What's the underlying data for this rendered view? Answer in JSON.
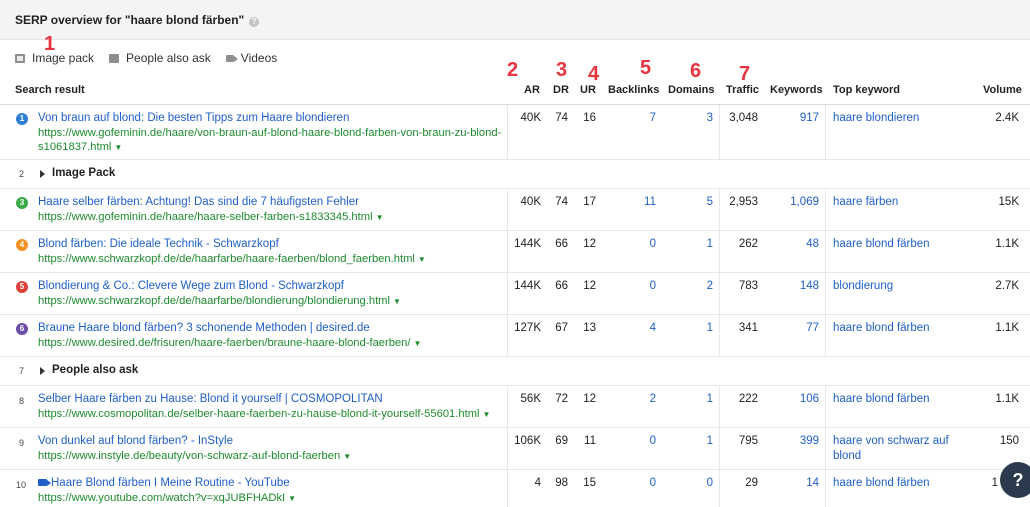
{
  "title": "SERP overview for \"haare blond färben\"",
  "help_glyph": "?",
  "features": [
    {
      "label": "Image pack",
      "icon": "image-icon"
    },
    {
      "label": "People also ask",
      "icon": "comment-icon"
    },
    {
      "label": "Videos",
      "icon": "video-icon"
    }
  ],
  "annotations": [
    "1",
    "2",
    "3",
    "4",
    "5",
    "6",
    "7"
  ],
  "columns": {
    "result": "Search result",
    "ar": "AR",
    "dr": "DR",
    "ur": "UR",
    "backlinks": "Backlinks",
    "domains": "Domains",
    "traffic": "Traffic",
    "keywords": "Keywords",
    "top_keyword": "Top keyword",
    "volume": "Volume"
  },
  "rows": [
    {
      "pos": "1",
      "title": "Von braun auf blond: Die besten Tipps zum Haare blondieren",
      "url": "https://www.gofeminin.de/haare/von-braun-auf-blond-haare-blond-farben-von-braun-zu-blond-",
      "url2": "s1061837.html",
      "ar": "40K",
      "dr": "74",
      "ur": "16",
      "backlinks": "7",
      "domains": "3",
      "traffic": "3,048",
      "keywords": "917",
      "top_keyword": "haare blondieren",
      "volume": "2.4K"
    },
    {
      "pos": "2",
      "group": "Image Pack"
    },
    {
      "pos": "3",
      "title": "Haare selber färben: Achtung! Das sind die 7 häufigsten Fehler",
      "url": "https://www.gofeminin.de/haare/haare-selber-farben-s1833345.html",
      "ar": "40K",
      "dr": "74",
      "ur": "17",
      "backlinks": "11",
      "domains": "5",
      "traffic": "2,953",
      "keywords": "1,069",
      "top_keyword": "haare färben",
      "volume": "15K"
    },
    {
      "pos": "4",
      "title": "Blond färben: Die ideale Technik - Schwarzkopf",
      "url": "https://www.schwarzkopf.de/de/haarfarbe/haare-faerben/blond_faerben.html",
      "ar": "144K",
      "dr": "66",
      "ur": "12",
      "backlinks": "0",
      "domains": "1",
      "traffic": "262",
      "keywords": "48",
      "top_keyword": "haare blond färben",
      "volume": "1.1K"
    },
    {
      "pos": "5",
      "title": "Blondierung & Co.: Clevere Wege zum Blond - Schwarzkopf",
      "url": "https://www.schwarzkopf.de/de/haarfarbe/blondierung/blondierung.html",
      "ar": "144K",
      "dr": "66",
      "ur": "12",
      "backlinks": "0",
      "domains": "2",
      "traffic": "783",
      "keywords": "148",
      "top_keyword": "blondierung",
      "volume": "2.7K"
    },
    {
      "pos": "6",
      "title": "Braune Haare blond färben? 3 schonende Methoden | desired.de",
      "url": "https://www.desired.de/frisuren/haare-faerben/braune-haare-blond-faerben/",
      "ar": "127K",
      "dr": "67",
      "ur": "13",
      "backlinks": "4",
      "domains": "1",
      "traffic": "341",
      "keywords": "77",
      "top_keyword": "haare blond färben",
      "volume": "1.1K"
    },
    {
      "pos": "7",
      "group": "People also ask"
    },
    {
      "pos": "8",
      "title": "Selber Haare färben zu Hause: Blond it yourself | COSMOPOLITAN",
      "url": "https://www.cosmopolitan.de/selber-haare-faerben-zu-hause-blond-it-yourself-55601.html",
      "ar": "56K",
      "dr": "72",
      "ur": "12",
      "backlinks": "2",
      "domains": "1",
      "traffic": "222",
      "keywords": "106",
      "top_keyword": "haare blond färben",
      "volume": "1.1K"
    },
    {
      "pos": "9",
      "title": "Von dunkel auf blond färben? - InStyle",
      "url": "https://www.instyle.de/beauty/von-schwarz-auf-blond-faerben",
      "ar": "106K",
      "dr": "69",
      "ur": "11",
      "backlinks": "0",
      "domains": "1",
      "traffic": "795",
      "keywords": "399",
      "top_keyword": "haare von schwarz auf",
      "top_keyword2": "blond",
      "volume": "150"
    },
    {
      "pos": "10",
      "title": "Haare Blond färben I Meine Routine - YouTube",
      "url": "https://www.youtube.com/watch?v=xqJUBFHADkI",
      "ar": "4",
      "dr": "98",
      "ur": "15",
      "backlinks": "0",
      "domains": "0",
      "traffic": "29",
      "keywords": "14",
      "top_keyword": "haare blond färben",
      "volume": "1"
    }
  ],
  "colors": {
    "link": "#1f5fc7",
    "url": "#1e8a2e",
    "annotation": "#e8343e",
    "badge_blue": "#2f7fd6",
    "badge_green": "#3aaa48",
    "badge_orange": "#f39222",
    "badge_red": "#e0403a",
    "badge_purple": "#6b4fa8"
  }
}
